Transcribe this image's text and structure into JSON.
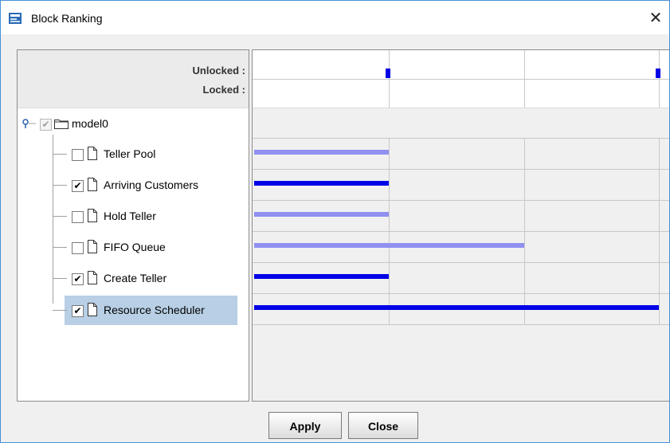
{
  "window": {
    "title": "Block Ranking",
    "close_glyph": "✕"
  },
  "header": {
    "unlocked_label": "Unlocked :",
    "locked_label": "Locked :"
  },
  "tree": {
    "root": {
      "label": "model0",
      "checked": true,
      "disabled": true,
      "icon": "folder-icon",
      "expander_icon": "tree-expander-icon"
    },
    "items": [
      {
        "label": "Teller Pool",
        "checked": false,
        "rank_fraction": 0.333,
        "selected": false
      },
      {
        "label": "Arriving Customers",
        "checked": true,
        "rank_fraction": 0.333,
        "selected": false
      },
      {
        "label": "Hold Teller",
        "checked": false,
        "rank_fraction": 0.333,
        "selected": false
      },
      {
        "label": "FIFO Queue",
        "checked": false,
        "rank_fraction": 0.667,
        "selected": false
      },
      {
        "label": "Create Teller",
        "checked": true,
        "rank_fraction": 0.333,
        "selected": false
      },
      {
        "label": "Resource Scheduler",
        "checked": true,
        "rank_fraction": 1.0,
        "selected": true
      }
    ]
  },
  "ranking": {
    "unlocked_markers": [
      0.333,
      1.0
    ],
    "locked_markers": [],
    "gridline_fractions": [
      0.333,
      0.667,
      1.0
    ]
  },
  "colors": {
    "checked_bar": "#0000e6",
    "unchecked_bar": "#9090f0",
    "selection": "#b8cfe5"
  },
  "footer": {
    "apply_label": "Apply",
    "close_label": "Close"
  }
}
